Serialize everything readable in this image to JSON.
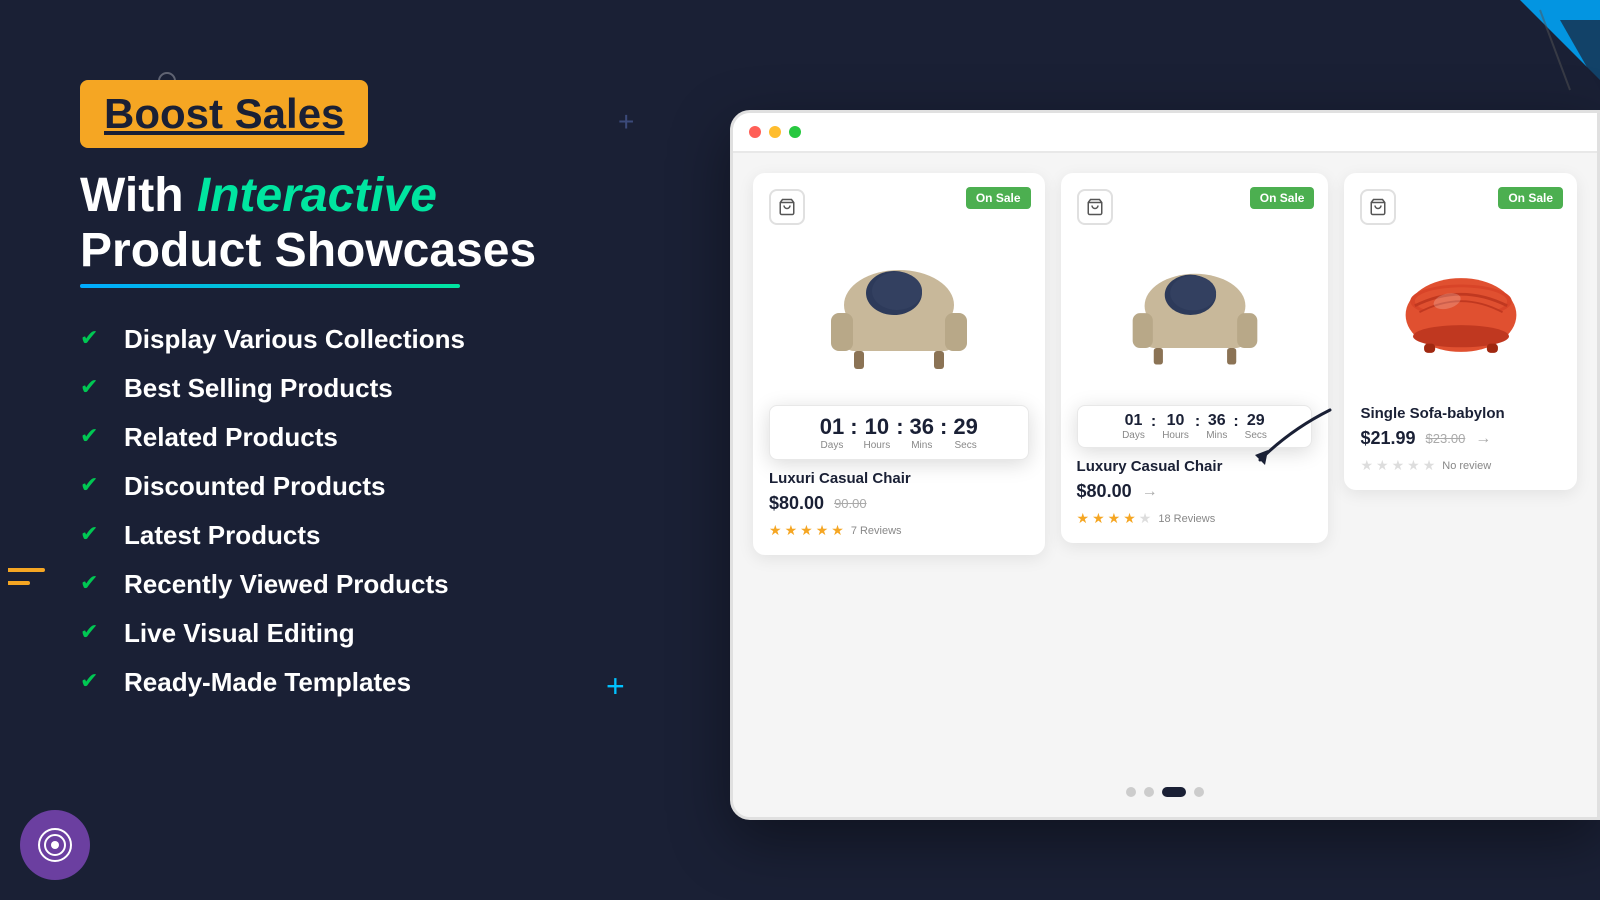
{
  "headline": {
    "boost": "Boost Sales",
    "with": "With",
    "interactive": "Interactive",
    "subtitle": "Product Showcases"
  },
  "features": [
    {
      "id": "collections",
      "label": "Display Various Collections"
    },
    {
      "id": "best-selling",
      "label": "Best Selling Products"
    },
    {
      "id": "related",
      "label": "Related Products"
    },
    {
      "id": "discounted",
      "label": "Discounted Products"
    },
    {
      "id": "latest",
      "label": "Latest Products"
    },
    {
      "id": "recently-viewed",
      "label": "Recently Viewed Products"
    },
    {
      "id": "live-editing",
      "label": "Live Visual Editing"
    },
    {
      "id": "templates",
      "label": "Ready-Made Templates"
    }
  ],
  "countdown": {
    "days": "01",
    "days_label": "Days",
    "hours": "10",
    "hours_label": "Hours",
    "mins": "36",
    "mins_label": "Mins",
    "secs": "29",
    "secs_label": "Secs"
  },
  "countdown2": {
    "days": "01",
    "days_label": "Days",
    "hours": "10",
    "hours_label": "Hours",
    "mins": "36",
    "mins_label": "Mins",
    "secs": "29",
    "secs_label": "Secs"
  },
  "products": [
    {
      "id": "product-1",
      "name": "Luxuri Casual Chair",
      "price": "$80.00",
      "old_price": "90.00",
      "reviews": "7 Reviews",
      "on_sale": "On Sale",
      "stars": 5,
      "color": "beige"
    },
    {
      "id": "product-2",
      "name": "Luxury Casual Chair",
      "price": "$80.00",
      "old_price": "",
      "reviews": "18 Reviews",
      "on_sale": "On Sale",
      "stars": 4,
      "color": "beige"
    },
    {
      "id": "product-3",
      "name": "Single Sofa-babylon",
      "price": "$21.99",
      "old_price": "$23.00",
      "reviews": "No review",
      "on_sale": "On Sale",
      "stars": 0,
      "color": "red"
    }
  ],
  "pagination": {
    "dots": [
      "inactive",
      "inactive",
      "active",
      "inactive"
    ]
  },
  "decor": {
    "plus_top": "+",
    "plus_bottom": "+"
  }
}
